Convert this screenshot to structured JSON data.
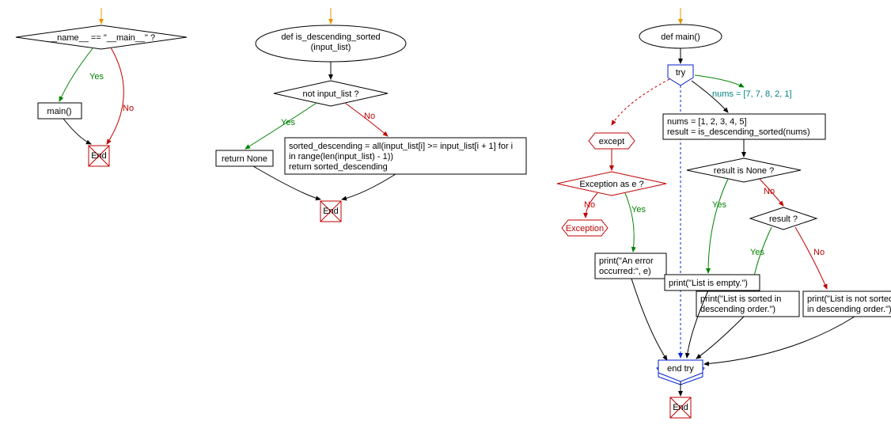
{
  "labels": {
    "yes": "Yes",
    "no": "No",
    "end": "End",
    "try": "try",
    "except": "except",
    "end_try": "end try",
    "exception": "Exception"
  },
  "chart1": {
    "decision": "__name__ == \"__main__\" ?",
    "call": "main()"
  },
  "chart2": {
    "def": "def is_descending_sorted\n(input_list)",
    "decision": "not input_list ?",
    "return_none": "return None",
    "body_line1": "sorted_descending = all(input_list[i] >= input_list[i + 1] for i",
    "body_line2": "in range(len(input_list) - 1))",
    "body_line3": "return sorted_descending"
  },
  "chart3": {
    "def": "def main()",
    "comment": "nums = [7, 7, 8, 2, 1]",
    "assign_line1": "nums  = [1, 2, 3, 4, 5]",
    "assign_line2": "result = is_descending_sorted(nums)",
    "except_cond": "Exception as e ?",
    "print_error_line1": "print(\"An error",
    "print_error_line2": "occurred:\", e)",
    "decision_none": "result is None ?",
    "decision_result": "result ?",
    "print_empty": "print(\"List is empty.\")",
    "print_sorted_line1": "print(\"List is sorted in",
    "print_sorted_line2": "descending order.\")",
    "print_not_sorted_line1": "print(\"List is not sorted",
    "print_not_sorted_line2": "in descending order.\")"
  }
}
